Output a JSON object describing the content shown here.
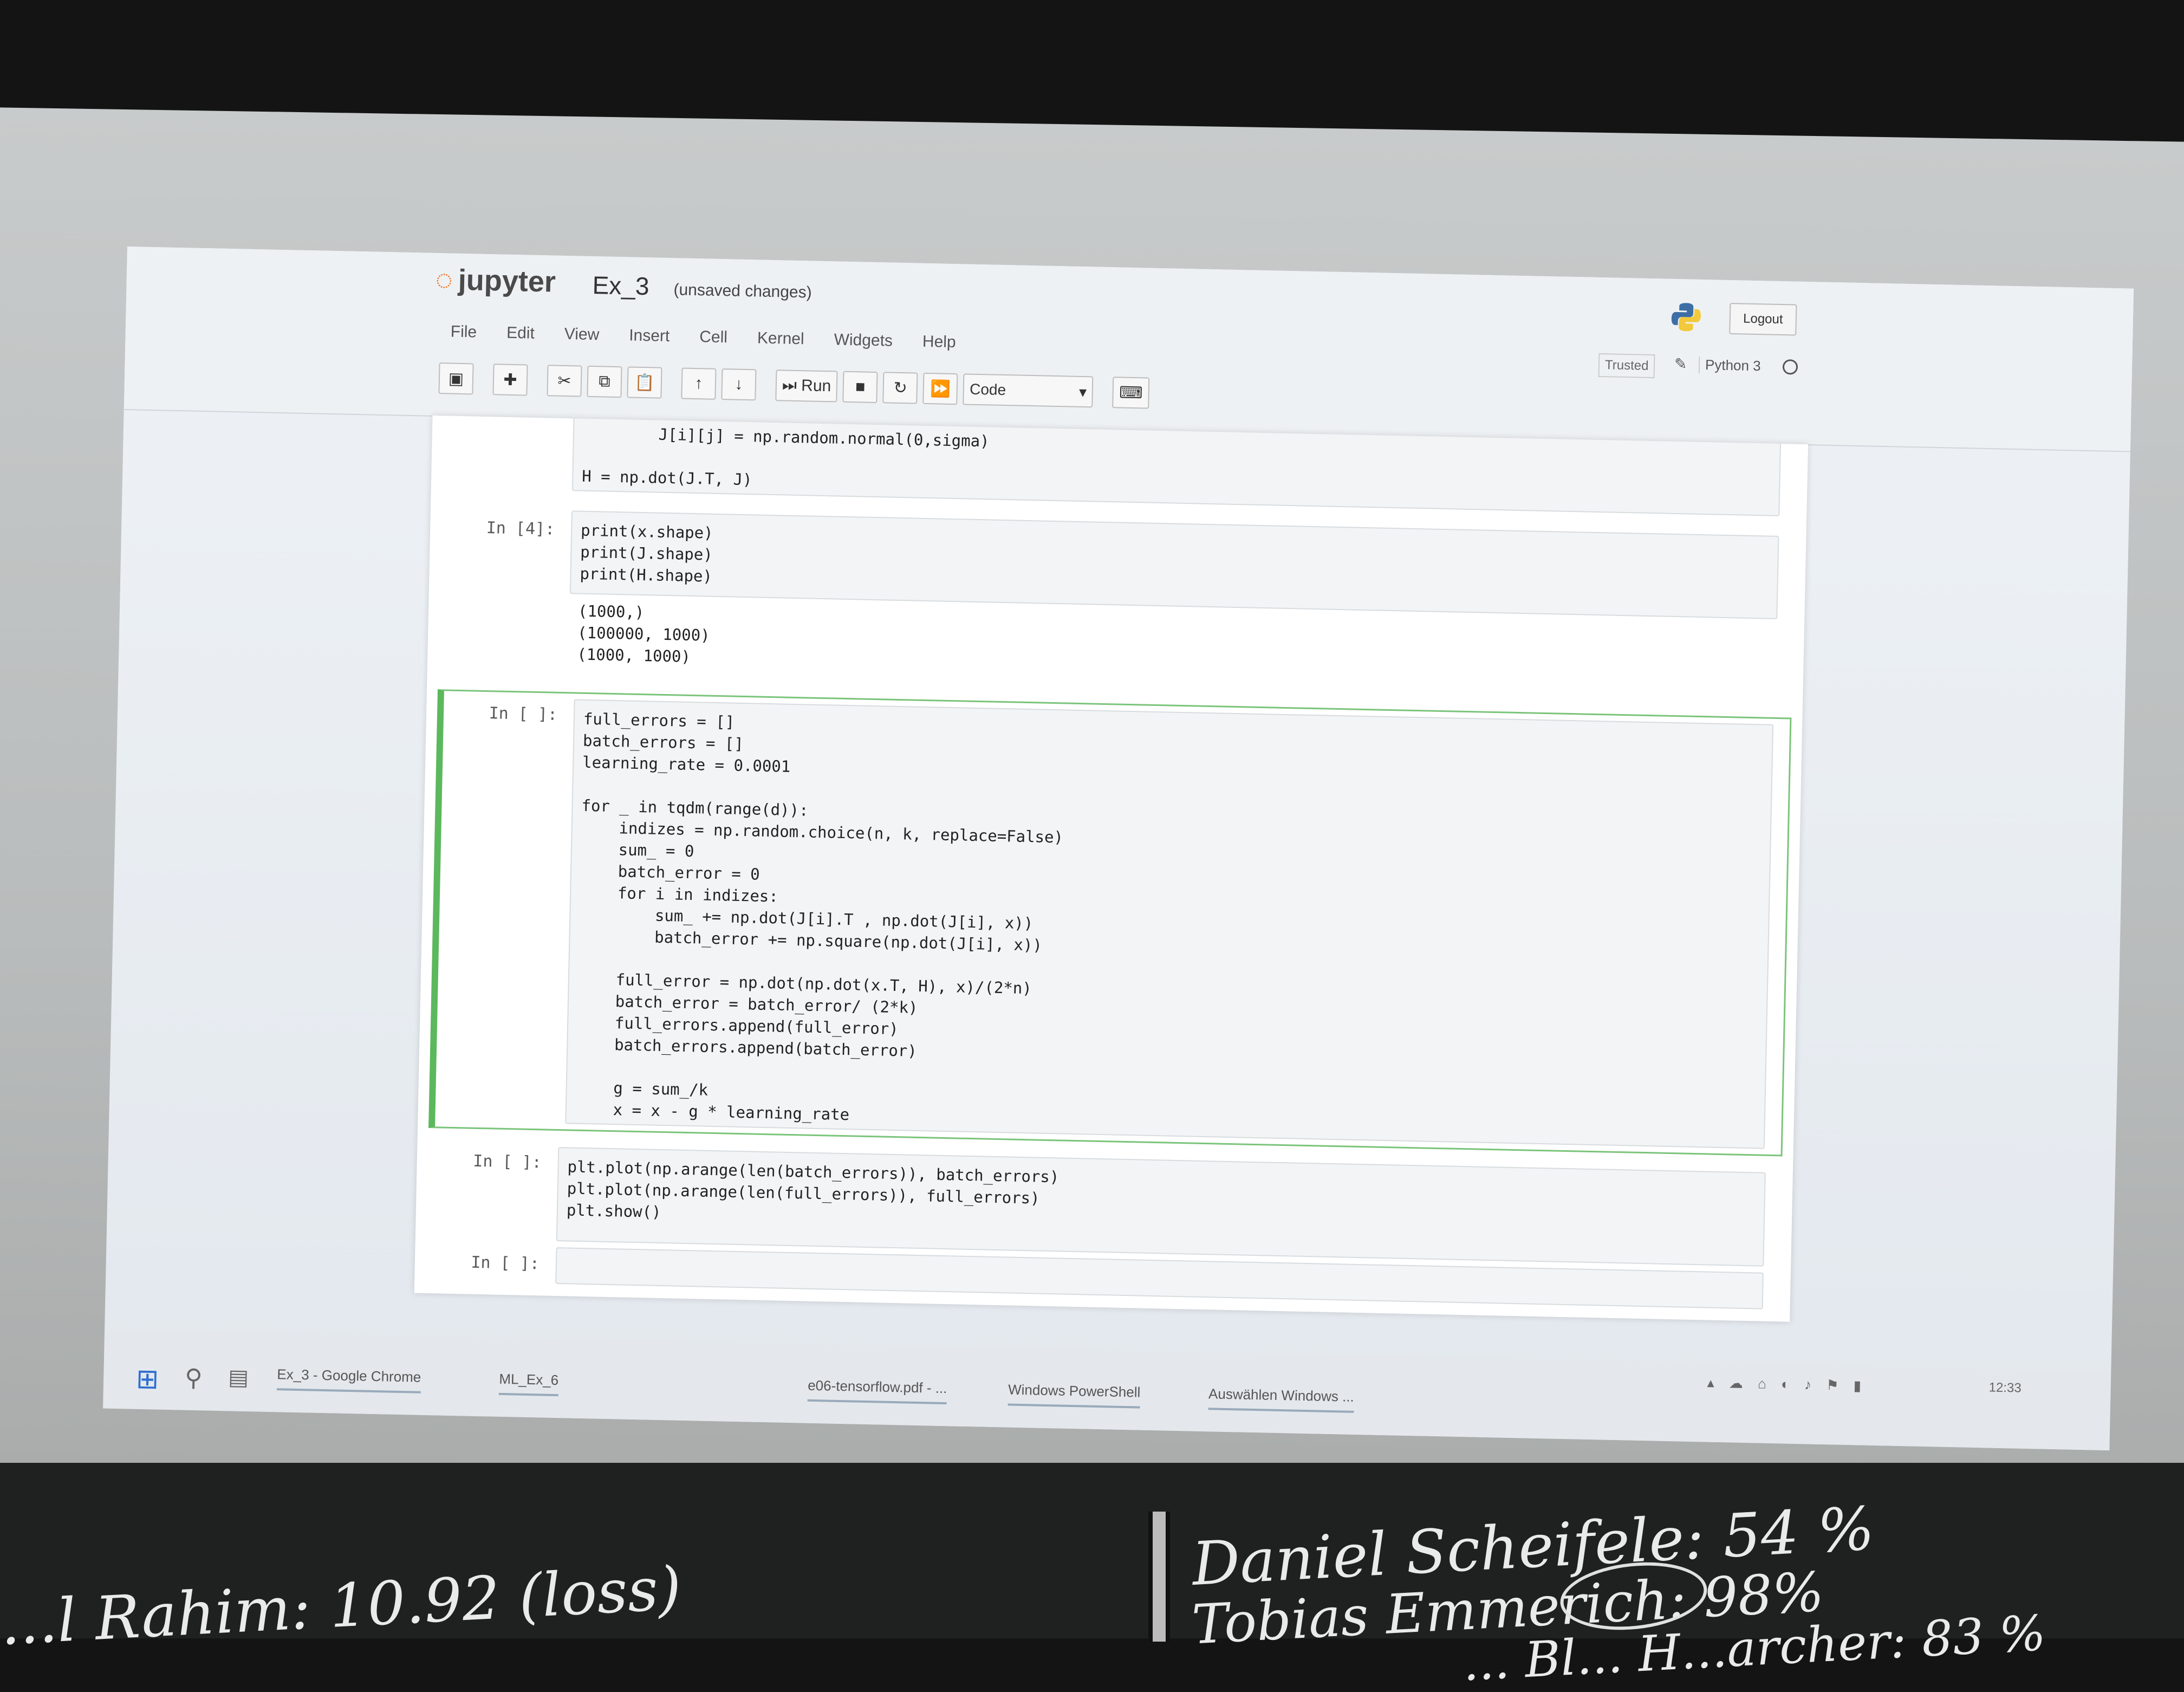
{
  "jupyter": {
    "logo_text": "jupyter",
    "notebook_name": "Ex_3",
    "status": "(unsaved changes)",
    "logout_label": "Logout",
    "menu": [
      "File",
      "Edit",
      "View",
      "Insert",
      "Cell",
      "Kernel",
      "Widgets",
      "Help"
    ],
    "trusted_label": "Trusted",
    "kernel_name": "Python 3",
    "toolbar": {
      "run_label": "Run",
      "cell_type": "Code"
    }
  },
  "cells": [
    {
      "prompt": "",
      "code": "        J[i][j] = np.random.normal(0,sigma)\n\nH = np.dot(J.T, J)"
    },
    {
      "prompt": "In [4]:",
      "code": "print(x.shape)\nprint(J.shape)\nprint(H.shape)",
      "output": "(1000,)\n(100000, 1000)\n(1000, 1000)"
    },
    {
      "prompt": "In [ ]:",
      "code": "full_errors = []\nbatch_errors = []\nlearning_rate = 0.0001\n\nfor _ in tqdm(range(d)):\n    indizes = np.random.choice(n, k, replace=False)\n    sum_ = 0\n    batch_error = 0\n    for i in indizes:\n        sum_ += np.dot(J[i].T , np.dot(J[i], x))\n        batch_error += np.square(np.dot(J[i], x))\n\n    full_error = np.dot(np.dot(x.T, H), x)/(2*n)\n    batch_error = batch_error/ (2*k)\n    full_errors.append(full_error)\n    batch_errors.append(batch_error)\n\n    g = sum_/k\n    x = x - g * learning_rate"
    },
    {
      "prompt": "In [ ]:",
      "code": "plt.plot(np.arange(len(batch_errors)), batch_errors)\nplt.plot(np.arange(len(full_errors)), full_errors)\nplt.show()"
    },
    {
      "prompt": "In [ ]:",
      "code": ""
    }
  ],
  "taskbar": {
    "items": [
      "Ex_3 - Google Chrome",
      "ML_Ex_6",
      "e06-tensorflow.pdf - ...",
      "Windows PowerShell",
      "Auswählen Windows ..."
    ],
    "clock": "12:33"
  },
  "blackboard": {
    "line1": "Daniel Scheifele: 54 %",
    "line2": "Tobias Emmerich: 98%",
    "line3": "... Bl... H...archer: 83 %",
    "line4": "...l Rahim: 10.92 (loss)"
  },
  "icons": [
    "save-icon",
    "plus-icon",
    "scissors-icon",
    "copy-icon",
    "paste-icon",
    "arrow-up-icon",
    "arrow-down-icon",
    "stop-icon",
    "restart-icon",
    "fast-forward-icon",
    "keyboard-icon"
  ]
}
